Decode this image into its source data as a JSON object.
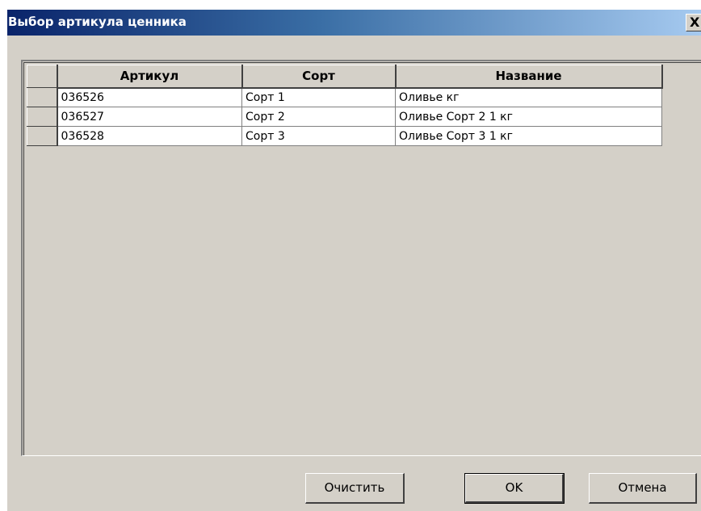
{
  "window": {
    "title": "Выбор артикула ценника",
    "close_label": "X"
  },
  "grid": {
    "columns": [
      "Артикул",
      "Сорт",
      "Название"
    ],
    "rows": [
      {
        "article": "036526",
        "grade": "Сорт 1",
        "name": "Оливье кг"
      },
      {
        "article": "036527",
        "grade": "Сорт 2",
        "name": "Оливье Сорт 2 1 кг"
      },
      {
        "article": "036528",
        "grade": "Сорт 3",
        "name": "Оливье Сорт 3 1 кг"
      }
    ]
  },
  "buttons": {
    "clear_label": "Очистить",
    "ok_label": "OK",
    "cancel_label": "Отмена"
  },
  "colors": {
    "titlebar_start": "#0a246a",
    "titlebar_end": "#a6caf0",
    "face": "#d4d0c8"
  }
}
